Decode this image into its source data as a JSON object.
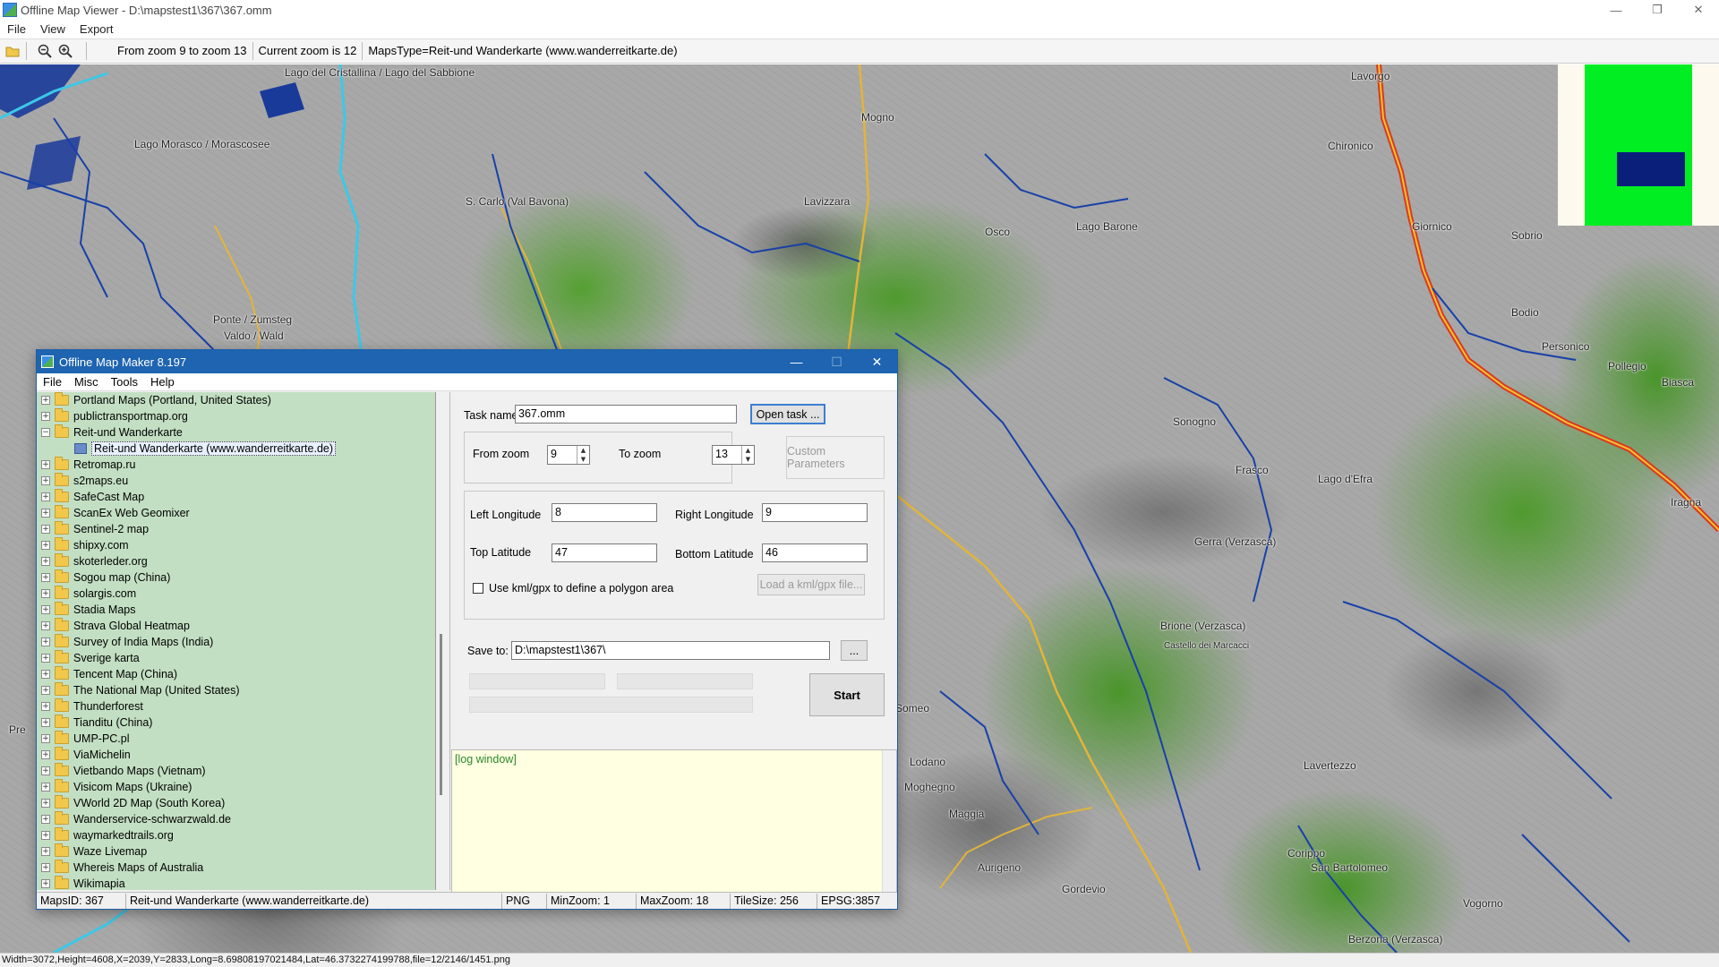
{
  "window": {
    "title": "Offline Map Viewer - D:\\mapstest1\\367\\367.omm",
    "menu": [
      "File",
      "View",
      "Export"
    ],
    "controls": {
      "minimize": "—",
      "maximize": "❐",
      "close": "✕"
    }
  },
  "toolbar": {
    "zoom_range": "From zoom 9 to zoom 13",
    "current_zoom": "Current zoom is 12",
    "maps_type": "MapsType=Reit-und Wanderkarte (www.wanderreitkarte.de)"
  },
  "map": {
    "labels": [
      "Lago del Cristallina / Lago del Sabbione",
      "Lago Morasco / Morascosee",
      "S. Carlo (Val Bavona)",
      "Ponte / Zumsteg",
      "Valdo / Wald",
      "Mogno",
      "Lavizzara",
      "Lago Barone",
      "Chironico",
      "Lavorgo",
      "Giornico",
      "Sobrio",
      "Bodio",
      "Personico",
      "Pollegio",
      "Biasca",
      "Iragna",
      "Sonogno",
      "Frasco",
      "Lago d'Efra",
      "Gerra (Verzasca)",
      "Brione (Verzasca)",
      "Castello dei Marcacci",
      "Lodano",
      "Aurigeno",
      "Gordevio",
      "Lavertezzo",
      "Corippo",
      "San Bartolomeo",
      "Vogorno",
      "Berzona (Verzasca)",
      "Someo",
      "Maggia",
      "Pre",
      "Moghegno",
      "Osco"
    ]
  },
  "overview_colors": {
    "background": "#fdf9ef",
    "area": "#00ee22",
    "view": "#0a1f7a"
  },
  "status": "Width=3072,Height=4608,X=2039,Y=2833,Long=8.69808197021484,Lat=46.3732274199788,file=12/2146/1451.png",
  "dialog": {
    "title": "Offline Map Maker 8.197",
    "menu": [
      "File",
      "Misc",
      "Tools",
      "Help"
    ],
    "controls": {
      "minimize": "—",
      "maximize": "☐",
      "close": "✕"
    },
    "tree": [
      {
        "label": "Portland Maps (Portland, United States)",
        "expanded": false
      },
      {
        "label": "publictransportmap.org",
        "expanded": false
      },
      {
        "label": "Reit-und Wanderkarte",
        "expanded": true
      },
      {
        "label": "Reit-und Wanderkarte (www.wanderreitkarte.de)",
        "child": true
      },
      {
        "label": "Retromap.ru",
        "expanded": false
      },
      {
        "label": "s2maps.eu",
        "expanded": false
      },
      {
        "label": "SafeCast Map",
        "expanded": false
      },
      {
        "label": "ScanEx Web Geomixer",
        "expanded": false
      },
      {
        "label": "Sentinel-2 map",
        "expanded": false
      },
      {
        "label": "shipxy.com",
        "expanded": false
      },
      {
        "label": "skoterleder.org",
        "expanded": false
      },
      {
        "label": "Sogou map (China)",
        "expanded": false
      },
      {
        "label": "solargis.com",
        "expanded": false
      },
      {
        "label": "Stadia Maps",
        "expanded": false
      },
      {
        "label": "Strava Global Heatmap",
        "expanded": false
      },
      {
        "label": "Survey of India Maps (India)",
        "expanded": false
      },
      {
        "label": "Sverige karta",
        "expanded": false
      },
      {
        "label": "Tencent Map (China)",
        "expanded": false
      },
      {
        "label": "The National Map (United States)",
        "expanded": false
      },
      {
        "label": "Thunderforest",
        "expanded": false
      },
      {
        "label": "Tianditu (China)",
        "expanded": false
      },
      {
        "label": "UMP-PC.pl",
        "expanded": false
      },
      {
        "label": "ViaMichelin",
        "expanded": false
      },
      {
        "label": "Vietbando Maps (Vietnam)",
        "expanded": false
      },
      {
        "label": "Visicom Maps (Ukraine)",
        "expanded": false
      },
      {
        "label": "VWorld 2D Map (South Korea)",
        "expanded": false
      },
      {
        "label": "Wanderservice-schwarzwald.de",
        "expanded": false
      },
      {
        "label": "waymarkedtrails.org",
        "expanded": false
      },
      {
        "label": "Waze Livemap",
        "expanded": false
      },
      {
        "label": "Whereis Maps of Australia",
        "expanded": false
      },
      {
        "label": "Wikimapia",
        "expanded": false
      }
    ],
    "form": {
      "task_name_label": "Task name",
      "task_name_value": "367.omm",
      "open_task": "Open task ...",
      "from_zoom_label": "From zoom",
      "from_zoom_value": "9",
      "to_zoom_label": "To zoom",
      "to_zoom_value": "13",
      "custom_params": "Custom Parameters",
      "left_lon_label": "Left Longitude",
      "left_lon_value": "8",
      "right_lon_label": "Right Longitude",
      "right_lon_value": "9",
      "top_lat_label": "Top Latitude",
      "top_lat_value": "47",
      "bottom_lat_label": "Bottom Latitude",
      "bottom_lat_value": "46",
      "kml_label": "Use kml/gpx to define a polygon area",
      "kml_checked": false,
      "load_kml": "Load a kml/gpx file...",
      "save_to_label": "Save to:",
      "save_to_value": "D:\\mapstest1\\367\\",
      "browse": "...",
      "start": "Start",
      "log": "[log window]"
    },
    "statusbar": {
      "maps_id": "MapsID: 367",
      "maps_name": "Reit-und Wanderkarte (www.wanderreitkarte.de)",
      "format": "PNG",
      "min_zoom": "MinZoom: 1",
      "max_zoom": "MaxZoom: 18",
      "tile_size": "TileSize: 256",
      "epsg": "EPSG:3857"
    }
  }
}
